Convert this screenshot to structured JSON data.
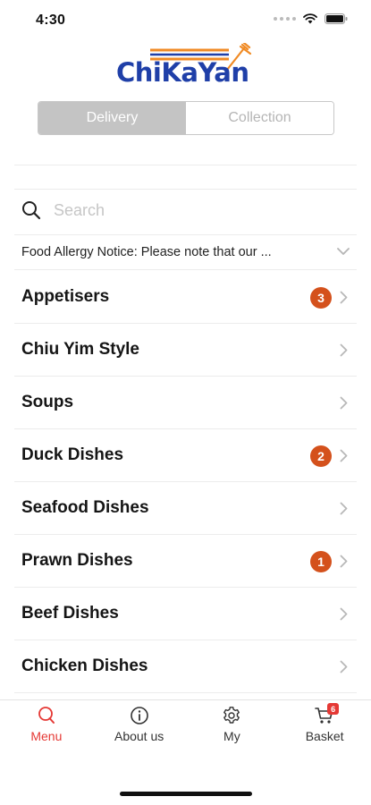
{
  "status": {
    "time": "4:30"
  },
  "logo": {
    "text": "ChiKaYan"
  },
  "order_type": {
    "options": [
      "Delivery",
      "Collection"
    ],
    "selected": "Delivery"
  },
  "search": {
    "placeholder": "Search"
  },
  "notice": {
    "text": "Food Allergy Notice: Please note that our ..."
  },
  "categories": [
    {
      "label": "Appetisers",
      "badge": "3"
    },
    {
      "label": "Chiu Yim Style",
      "badge": ""
    },
    {
      "label": "Soups",
      "badge": ""
    },
    {
      "label": "Duck Dishes",
      "badge": "2"
    },
    {
      "label": "Seafood Dishes",
      "badge": ""
    },
    {
      "label": "Prawn Dishes",
      "badge": "1"
    },
    {
      "label": "Beef Dishes",
      "badge": ""
    },
    {
      "label": "Chicken Dishes",
      "badge": ""
    }
  ],
  "tabs": [
    {
      "label": "Menu",
      "icon": "search-icon",
      "active": true
    },
    {
      "label": "About us",
      "icon": "info-icon",
      "active": false
    },
    {
      "label": "My",
      "icon": "gear-icon",
      "active": false
    },
    {
      "label": "Basket",
      "icon": "cart-icon",
      "active": false,
      "badge": "6"
    }
  ],
  "colors": {
    "accent": "#e53935",
    "badge": "#d4511c",
    "brand_blue": "#1f3fa8",
    "brand_orange": "#f08a24"
  }
}
